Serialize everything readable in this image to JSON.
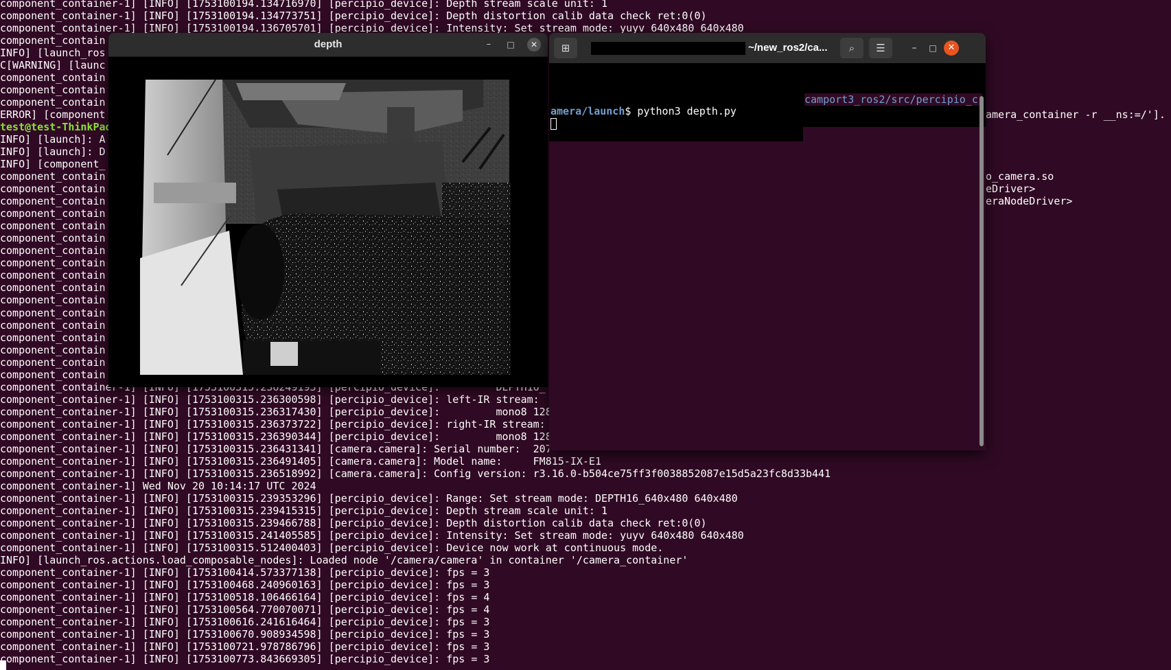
{
  "background_terminal": {
    "lines": [
      {
        "t": "component_container-1] [INFO] [1753100194.134716970] [percipio_device]: Depth stream scale unit: 1"
      },
      {
        "t": "component_container-1] [INFO] [1753100194.134773751] [percipio_device]: Depth distortion calib data check ret:0(0)"
      },
      {
        "t": "component_container-1] [INFO] [1753100194.136705701] [percipio_device]: Intensity: Set stream mode: yuyv 640x480 640x480"
      },
      {
        "t": "component_contain"
      },
      {
        "t": "INFO] [launch_ros"
      },
      {
        "t": "C[WARNING] [launc"
      },
      {
        "t": "component_contain"
      },
      {
        "t": "component_contain"
      },
      {
        "t": "component_contain"
      },
      {
        "t": "ERROR] [component"
      },
      {
        "t": "test@test-ThinkPad",
        "c": "green"
      },
      {
        "t": "INFO] [launch]: A"
      },
      {
        "t": "INFO] [launch]: D"
      },
      {
        "t": "INFO] [component_"
      },
      {
        "t": "component_contain"
      },
      {
        "t": "component_contain"
      },
      {
        "t": "component_contain"
      },
      {
        "t": "component_contain"
      },
      {
        "t": "component_contain"
      },
      {
        "t": "component_contain"
      },
      {
        "t": "component_contain"
      },
      {
        "t": "component_contain"
      },
      {
        "t": "component_contain"
      },
      {
        "t": "component_contain"
      },
      {
        "t": "component_contain"
      },
      {
        "t": "component_contain"
      },
      {
        "t": "component_contain"
      },
      {
        "t": "component_contain"
      },
      {
        "t": "component_contain"
      },
      {
        "t": "component_contain"
      },
      {
        "t": "component_contain"
      },
      {
        "t": "component_container-1] [INFO] [1753100315.236249193] [percipio_device]:         DEPTH16_"
      },
      {
        "t": "component_container-1] [INFO] [1753100315.236300598] [percipio_device]: left-IR stream:"
      },
      {
        "t": "component_container-1] [INFO] [1753100315.236317430] [percipio_device]:         mono8 128"
      },
      {
        "t": "component_container-1] [INFO] [1753100315.236373722] [percipio_device]: right-IR stream:"
      },
      {
        "t": "component_container-1] [INFO] [1753100315.236390344] [percipio_device]:         mono8 128"
      },
      {
        "t": "component_container-1] [INFO] [1753100315.236431341] [camera.camera]: Serial number:  207"
      },
      {
        "t": "component_container-1] [INFO] [1753100315.236491405] [camera.camera]: Model name:     FM815-IX-E1"
      },
      {
        "t": "component_container-1] [INFO] [1753100315.236518992] [camera.camera]: Config version: r3.16.0-b504ce75ff3f0038852087e15d5a23fc8d33b441"
      },
      {
        "t": "component_container-1] Wed Nov 20 10:14:17 UTC 2024"
      },
      {
        "t": "component_container-1] [INFO] [1753100315.239353296] [percipio_device]: Range: Set stream mode: DEPTH16_640x480 640x480"
      },
      {
        "t": "component_container-1] [INFO] [1753100315.239415315] [percipio_device]: Depth stream scale unit: 1"
      },
      {
        "t": "component_container-1] [INFO] [1753100315.239466788] [percipio_device]: Depth distortion calib data check ret:0(0)"
      },
      {
        "t": "component_container-1] [INFO] [1753100315.241405585] [percipio_device]: Intensity: Set stream mode: yuyv 640x480 640x480"
      },
      {
        "t": "component_container-1] [INFO] [1753100315.512400403] [percipio_device]: Device now work at continuous mode."
      },
      {
        "t": "INFO] [launch_ros.actions.load_composable_nodes]: Loaded node '/camera/camera' in container '/camera_container'"
      },
      {
        "t": "component_container-1] [INFO] [1753100414.573377138] [percipio_device]: fps = 3"
      },
      {
        "t": "component_container-1] [INFO] [1753100468.240960163] [percipio_device]: fps = 3"
      },
      {
        "t": "component_container-1] [INFO] [1753100518.106466164] [percipio_device]: fps = 4"
      },
      {
        "t": "component_container-1] [INFO] [1753100564.770070071] [percipio_device]: fps = 4"
      },
      {
        "t": "component_container-1] [INFO] [1753100616.241616464] [percipio_device]: fps = 3"
      },
      {
        "t": "component_container-1] [INFO] [1753100670.908934598] [percipio_device]: fps = 3"
      },
      {
        "t": "component_container-1] [INFO] [1753100721.978786796] [percipio_device]: fps = 3"
      },
      {
        "t": "component_container-1] [INFO] [1753100773.843669305] [percipio_device]: fps = 3"
      }
    ],
    "right_fragments": [
      {
        "text": "amera_container -r __ns:=/']."
      },
      {
        "text": "o_camera.so"
      },
      {
        "text": "eDriver>"
      },
      {
        "text": "eraNodeDriver>"
      }
    ]
  },
  "depth_window": {
    "title": "depth",
    "minimize_glyph": "–",
    "maximize_glyph": "□",
    "close_glyph": "✕"
  },
  "terminal_window": {
    "title": "~/new_ros2/ca...",
    "new_tab_glyph": "⊞",
    "search_glyph": "⌕",
    "menu_glyph": "☰",
    "minimize_glyph": "–",
    "maximize_glyph": "□",
    "close_glyph": "✕",
    "path_line": "camport3_ros2/src/percipio_c",
    "prompt_dir": "amera/launch",
    "prompt_cmd": "$ python3 depth.py"
  }
}
